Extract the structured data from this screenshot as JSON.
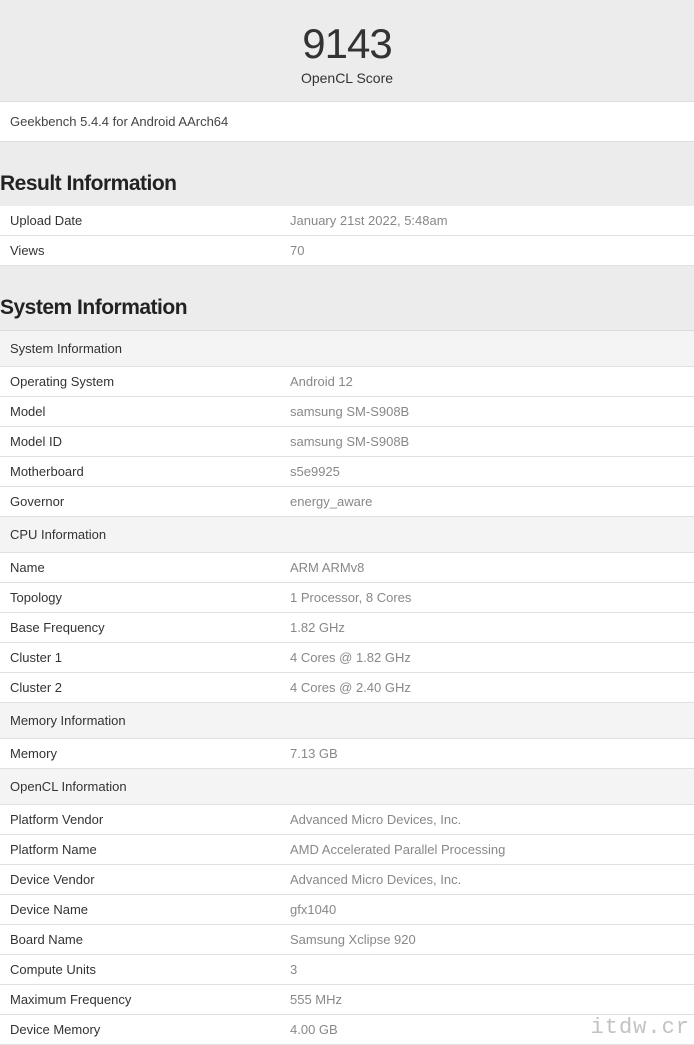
{
  "score": {
    "value": "9143",
    "label": "OpenCL Score"
  },
  "version": "Geekbench 5.4.4 for Android AArch64",
  "sections": {
    "result_title": "Result Information",
    "result_rows": [
      {
        "label": "Upload Date",
        "value": "January 21st 2022, 5:48am"
      },
      {
        "label": "Views",
        "value": "70"
      }
    ],
    "system_title": "System Information",
    "system_subheader": "System Information",
    "system_rows": [
      {
        "label": "Operating System",
        "value": "Android 12"
      },
      {
        "label": "Model",
        "value": "samsung SM-S908B"
      },
      {
        "label": "Model ID",
        "value": "samsung SM-S908B"
      },
      {
        "label": "Motherboard",
        "value": "s5e9925"
      },
      {
        "label": "Governor",
        "value": "energy_aware"
      }
    ],
    "cpu_subheader": "CPU Information",
    "cpu_rows": [
      {
        "label": "Name",
        "value": "ARM ARMv8"
      },
      {
        "label": "Topology",
        "value": "1 Processor, 8 Cores"
      },
      {
        "label": "Base Frequency",
        "value": "1.82 GHz"
      },
      {
        "label": "Cluster 1",
        "value": "4 Cores @ 1.82 GHz"
      },
      {
        "label": "Cluster 2",
        "value": "4 Cores @ 2.40 GHz"
      }
    ],
    "memory_subheader": "Memory Information",
    "memory_rows": [
      {
        "label": "Memory",
        "value": "7.13 GB"
      }
    ],
    "opencl_subheader": "OpenCL Information",
    "opencl_rows": [
      {
        "label": "Platform Vendor",
        "value": "Advanced Micro Devices, Inc."
      },
      {
        "label": "Platform Name",
        "value": "AMD Accelerated Parallel Processing"
      },
      {
        "label": "Device Vendor",
        "value": "Advanced Micro Devices, Inc."
      },
      {
        "label": "Device Name",
        "value": "gfx1040"
      },
      {
        "label": "Board Name",
        "value": "Samsung Xclipse 920"
      },
      {
        "label": "Compute Units",
        "value": "3"
      },
      {
        "label": "Maximum Frequency",
        "value": "555 MHz"
      },
      {
        "label": "Device Memory",
        "value": "4.00 GB"
      }
    ]
  },
  "watermark": "itdw.cr"
}
